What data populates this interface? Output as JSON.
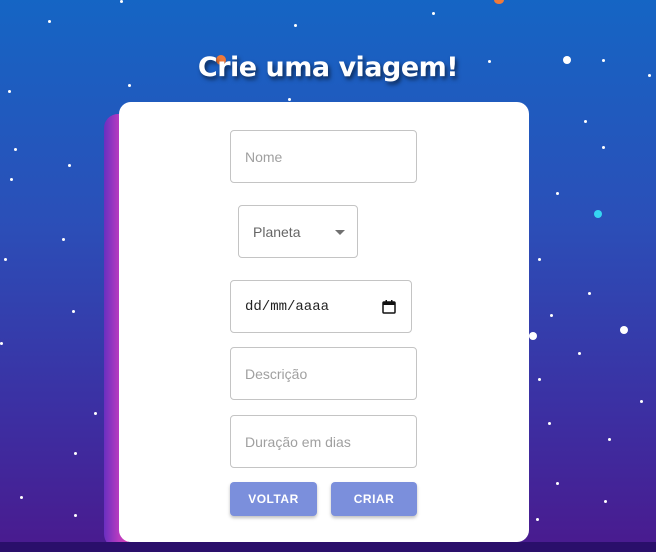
{
  "page": {
    "title": "Crie uma viagem!"
  },
  "form": {
    "nome_placeholder": "Nome",
    "planeta_label": "Planeta",
    "date_placeholder": "dd/mm/aaaa",
    "descricao_placeholder": "Descrição",
    "duracao_placeholder": "Duração em dias"
  },
  "buttons": {
    "voltar_label": "VOLTAR",
    "criar_label": "CRIAR"
  },
  "icons": {
    "date": "calendar-icon",
    "select": "chevron-down-icon"
  },
  "colors": {
    "button": "#7b8fdc",
    "accent_dot": "#f07a3a",
    "cyan_star": "#35d6f2"
  }
}
